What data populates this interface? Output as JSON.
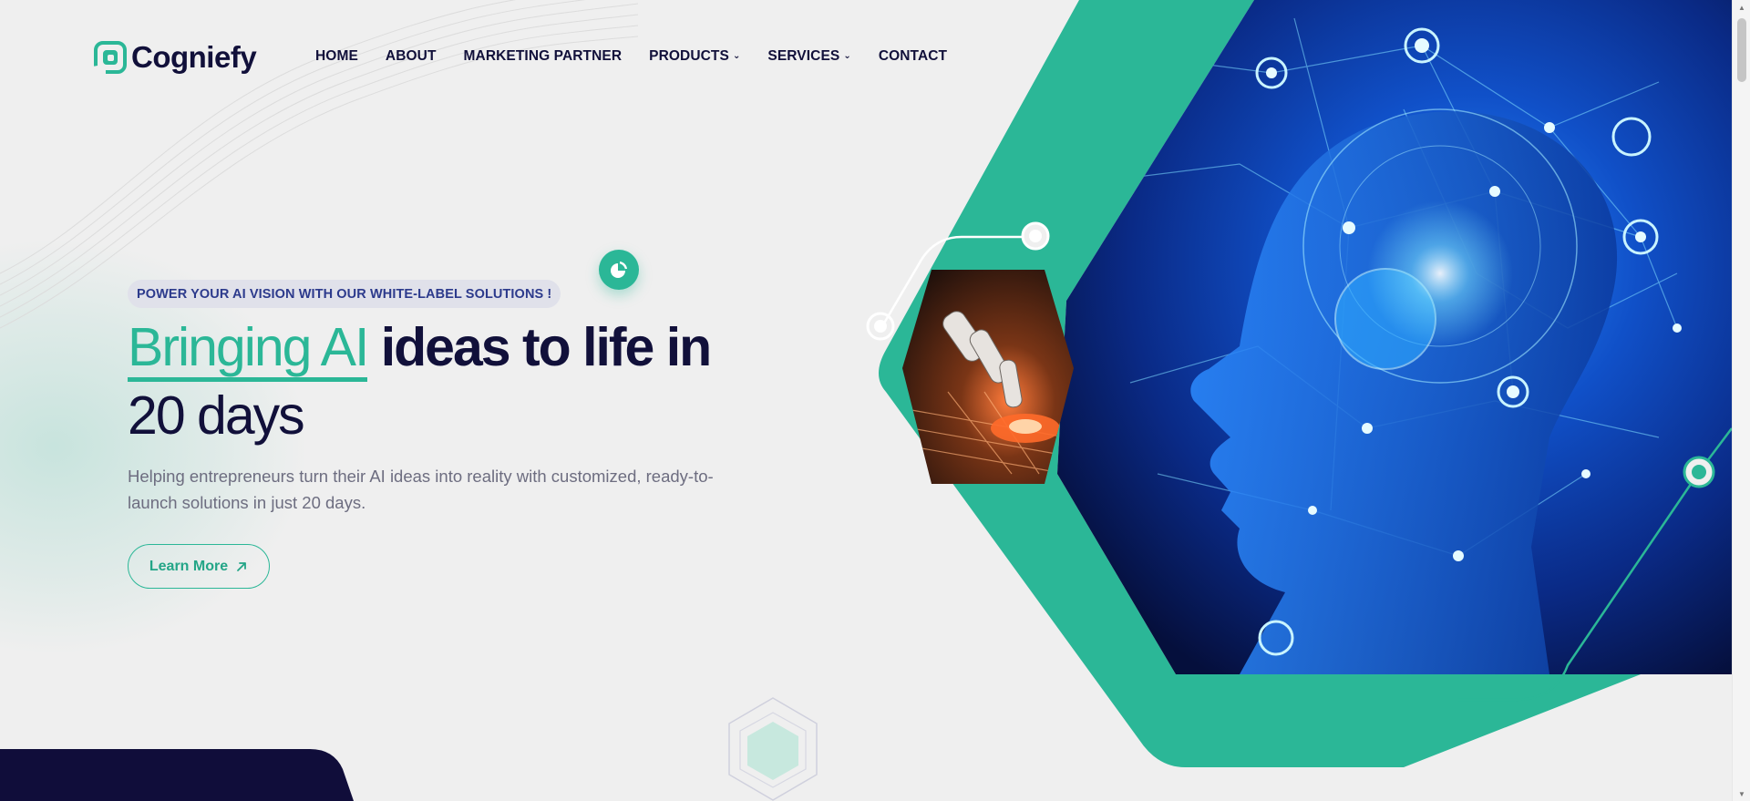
{
  "brand": {
    "name": "Cogniefy",
    "accent": "#2bb797",
    "navy": "#11103a"
  },
  "nav": {
    "items": [
      {
        "label": "HOME"
      },
      {
        "label": "ABOUT"
      },
      {
        "label": "MARKETING PARTNER"
      },
      {
        "label": "PRODUCTS",
        "dropdown": true
      },
      {
        "label": "SERVICES",
        "dropdown": true
      },
      {
        "label": "CONTACT"
      }
    ]
  },
  "hero": {
    "tagline": "POWER YOUR AI VISION WITH OUR WHITE-LABEL SOLUTIONS !",
    "headline_accent": "Bringing AI",
    "headline_bold": " ideas to life in",
    "headline_light": "20 days",
    "subtext": "Helping entrepreneurs turn their AI ideas into reality with customized, ready-to-launch solutions in just 20 days.",
    "cta_label": "Learn More"
  },
  "icons": {
    "logo": "cogniefy-logo-icon",
    "chevron": "chevron-down-icon",
    "arrow": "arrow-up-right-icon",
    "badge": "pie-chart-icon"
  }
}
